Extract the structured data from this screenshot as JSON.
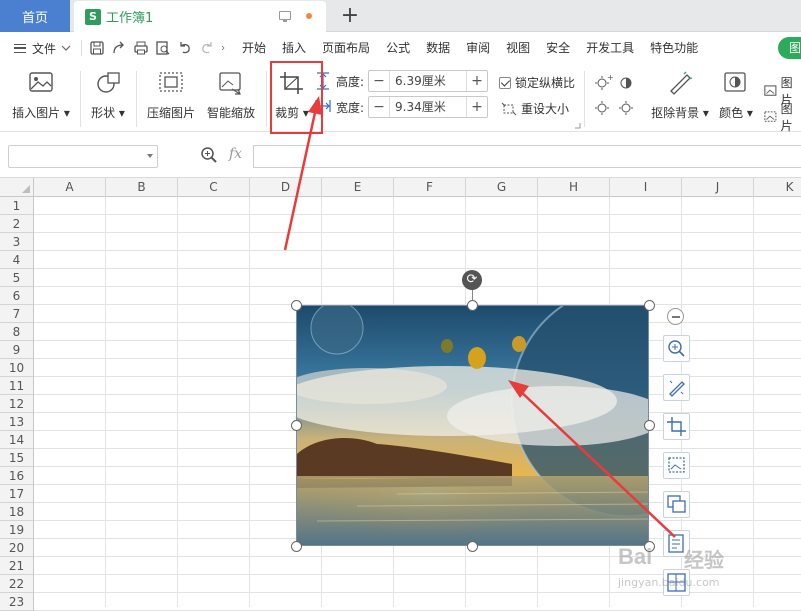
{
  "tabs": {
    "home": "首页",
    "doc_icon": "S",
    "doc_title": "工作簿1",
    "new_tab": "+"
  },
  "menu": {
    "file": "文件",
    "items": [
      "开始",
      "插入",
      "页面布局",
      "公式",
      "数据",
      "审阅",
      "视图",
      "安全",
      "开发工具",
      "特色功能"
    ],
    "pill": "图"
  },
  "ribbon": {
    "insert_picture": "插入图片",
    "shape": "形状",
    "compress": "压缩图片",
    "smart_scale": "智能缩放",
    "crop": "裁剪",
    "height_label": "高度:",
    "height_value": "6.39厘米",
    "width_label": "宽度:",
    "width_value": "9.34厘米",
    "lock_ratio": "锁定纵横比",
    "reset_size": "重设大小",
    "remove_bg": "抠除背景",
    "color": "颜色",
    "pic_a": "图片",
    "pic_b": "图片"
  },
  "formula": {
    "fx": "fx",
    "cell_ref": "",
    "content": ""
  },
  "columns": [
    "A",
    "B",
    "C",
    "D",
    "E",
    "F",
    "G",
    "H",
    "I",
    "J",
    "K"
  ],
  "rows": [
    "1",
    "2",
    "3",
    "4",
    "5",
    "6",
    "7",
    "8",
    "9",
    "10",
    "11",
    "12",
    "13",
    "14",
    "15",
    "16",
    "17",
    "18",
    "19",
    "20",
    "21",
    "22",
    "23"
  ],
  "watermark": {
    "brand": "Bai",
    "cn": "经验",
    "url": "jingyan.baidu.com"
  },
  "colors": {
    "accent_green": "#2e9d5b",
    "home_blue": "#4b7fd0",
    "highlight_red": "#e83b3b"
  }
}
